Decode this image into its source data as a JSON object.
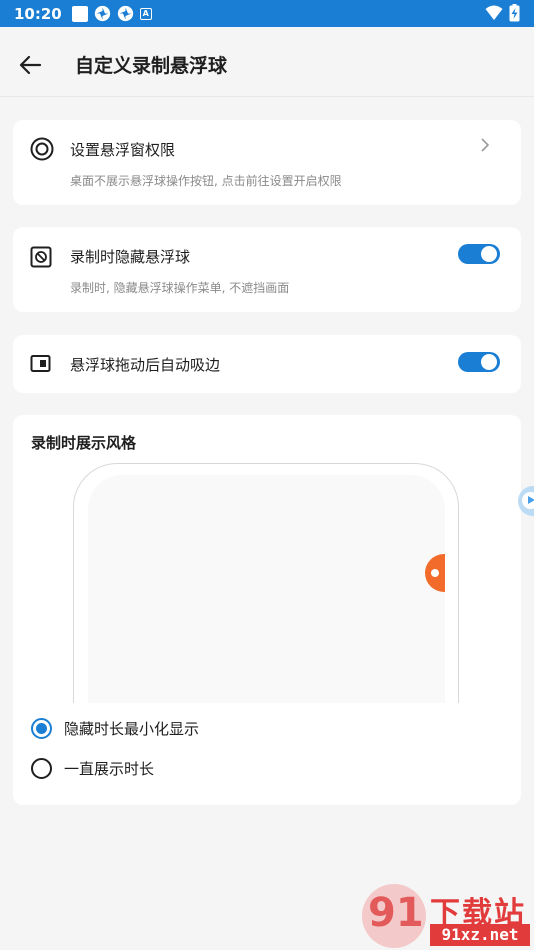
{
  "status_bar": {
    "time": "10:20",
    "icons": [
      "square-notification-icon",
      "fan-icon",
      "fan-icon",
      "a-box-icon"
    ],
    "right_icons": [
      "wifi-icon",
      "battery-charging-icon"
    ]
  },
  "header": {
    "back_icon": "arrow-left-icon",
    "title": "自定义录制悬浮球"
  },
  "permission_card": {
    "icon": "target-circle-icon",
    "title": "设置悬浮窗权限",
    "subtitle": "桌面不展示悬浮球操作按钮, 点击前往设置开启权限",
    "chevron": "chevron-right-icon"
  },
  "hide_card": {
    "icon": "prohibited-square-icon",
    "title": "录制时隐藏悬浮球",
    "subtitle": "录制时, 隐藏悬浮球操作菜单, 不遮挡画面",
    "toggle_on": true
  },
  "snap_card": {
    "icon": "edge-snap-icon",
    "title": "悬浮球拖动后自动吸边",
    "toggle_on": true
  },
  "style_card": {
    "title": "录制时展示风格",
    "options": [
      {
        "label": "隐藏时长最小化显示",
        "checked": true
      },
      {
        "label": "一直展示时长",
        "checked": false
      }
    ]
  },
  "colors": {
    "accent": "#1a7fd4",
    "float_ball": "#f26b2a",
    "background": "#f5f5f5"
  },
  "watermark": {
    "logo": "91",
    "top": "下载站",
    "bottom": "91xz.net"
  }
}
